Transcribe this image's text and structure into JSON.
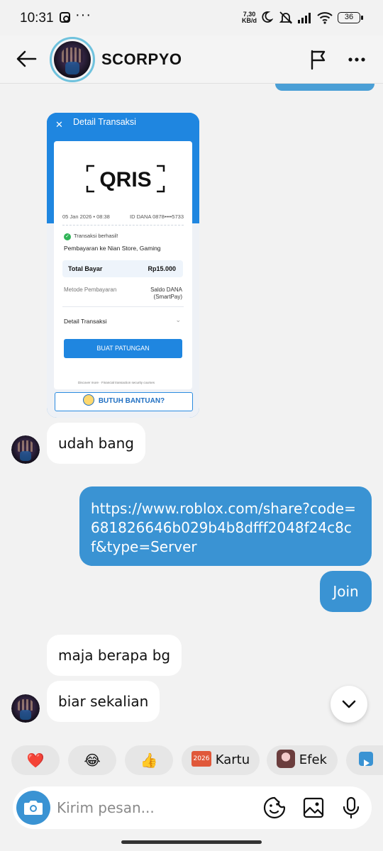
{
  "status_bar": {
    "time": "10:31",
    "network_speed_value": "7,30",
    "network_speed_unit": "KB/d",
    "battery": "36"
  },
  "header": {
    "contact_name": "SCORPYO"
  },
  "image_message": {
    "title": "Detail Transaksi",
    "logo_text": "QRIS",
    "date": "05 Jan 2026 • 08:38",
    "dana_id": "ID DANA 0878••••5733",
    "status": "Transaksi berhasil!",
    "merchant": "Pembayaran ke Nian Store, Gaming",
    "total_label": "Total Bayar",
    "total_value": "Rp15.000",
    "method_label": "Metode Pembayaran",
    "method_value": "Saldo DANA (SmartPay)",
    "detail_label": "Detail Transaksi",
    "action_button": "BUAT PATUNGAN",
    "discover_text": "Discover more  ·  Financial transaction security courses",
    "help_button": "BUTUH BANTUAN?"
  },
  "messages": {
    "m1": "udah bang",
    "m2_line1": "https://www.roblox.com/share?code=",
    "m2_line2": "681826646b029b4b8dfff2048f24c8c",
    "m2_line3": "f&type=Server",
    "m3": "Join",
    "m4": "maja berapa bg",
    "m5": "biar sekalian"
  },
  "quick_replies": {
    "heart": "❤️",
    "laugh": "😂",
    "thumbs": "👍",
    "kartu_badge": "2026",
    "kartu_label": "Kartu",
    "efek_label": "Efek"
  },
  "composer": {
    "placeholder": "Kirim pesan..."
  },
  "colors": {
    "accent": "#3a93d3",
    "background": "#f2f2f2",
    "dana_blue": "#1f86e0"
  }
}
